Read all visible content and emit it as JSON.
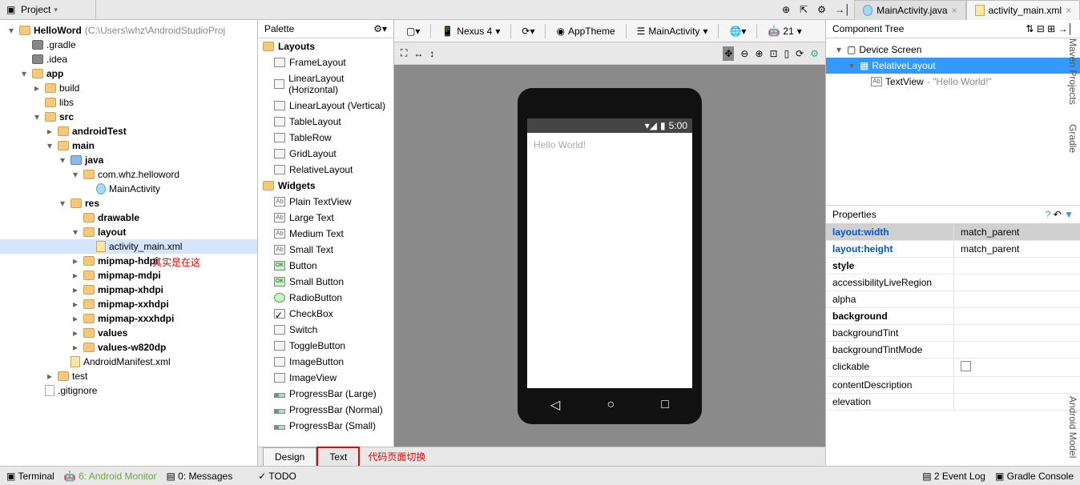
{
  "toolbar": {
    "project_label": "Project"
  },
  "editor_tabs": [
    {
      "icon": "c",
      "label": "MainActivity.java"
    },
    {
      "icon": "xml",
      "label": "activity_main.xml"
    }
  ],
  "tree": {
    "root": "HelloWord",
    "root_path": "(C:\\Users\\whz\\AndroidStudioProj",
    "items": [
      {
        "d": 1,
        "e": "",
        "i": "fold-dark",
        "t": ".gradle"
      },
      {
        "d": 1,
        "e": "",
        "i": "fold-dark",
        "t": ".idea"
      },
      {
        "d": 1,
        "e": "▾",
        "i": "fold",
        "t": "app",
        "b": 1
      },
      {
        "d": 2,
        "e": "▸",
        "i": "fold",
        "t": "build"
      },
      {
        "d": 2,
        "e": "",
        "i": "fold",
        "t": "libs"
      },
      {
        "d": 2,
        "e": "▾",
        "i": "fold",
        "t": "src",
        "b": 1
      },
      {
        "d": 3,
        "e": "▸",
        "i": "fold",
        "t": "androidTest",
        "b": 1
      },
      {
        "d": 3,
        "e": "▾",
        "i": "fold",
        "t": "main",
        "b": 1
      },
      {
        "d": 4,
        "e": "▾",
        "i": "fold-blue",
        "t": "java",
        "b": 1
      },
      {
        "d": 5,
        "e": "▾",
        "i": "fold",
        "t": "com.whz.helloword"
      },
      {
        "d": 6,
        "e": "",
        "i": "c",
        "t": "MainActivity"
      },
      {
        "d": 4,
        "e": "▾",
        "i": "fold",
        "t": "res",
        "b": 1
      },
      {
        "d": 5,
        "e": "",
        "i": "fold",
        "t": "drawable",
        "b": 1
      },
      {
        "d": 5,
        "e": "▾",
        "i": "fold",
        "t": "layout",
        "b": 1
      },
      {
        "d": 6,
        "e": "",
        "i": "xml",
        "t": "activity_main.xml",
        "sel": 1
      },
      {
        "d": 5,
        "e": "▸",
        "i": "fold",
        "t": "mipmap-hdpi",
        "b": 1
      },
      {
        "d": 5,
        "e": "▸",
        "i": "fold",
        "t": "mipmap-mdpi",
        "b": 1
      },
      {
        "d": 5,
        "e": "▸",
        "i": "fold",
        "t": "mipmap-xhdpi",
        "b": 1
      },
      {
        "d": 5,
        "e": "▸",
        "i": "fold",
        "t": "mipmap-xxhdpi",
        "b": 1
      },
      {
        "d": 5,
        "e": "▸",
        "i": "fold",
        "t": "mipmap-xxxhdpi",
        "b": 1
      },
      {
        "d": 5,
        "e": "▸",
        "i": "fold",
        "t": "values",
        "b": 1
      },
      {
        "d": 5,
        "e": "▸",
        "i": "fold",
        "t": "values-w820dp",
        "b": 1
      },
      {
        "d": 4,
        "e": "",
        "i": "xml",
        "t": "AndroidManifest.xml"
      },
      {
        "d": 3,
        "e": "▸",
        "i": "fold",
        "t": "test"
      },
      {
        "d": 2,
        "e": "",
        "i": "file",
        "t": ".gitignore"
      }
    ]
  },
  "palette": {
    "title": "Palette",
    "groups": [
      {
        "name": "Layouts",
        "items": [
          "FrameLayout",
          "LinearLayout (Horizontal)",
          "LinearLayout (Vertical)",
          "TableLayout",
          "TableRow",
          "GridLayout",
          "RelativeLayout"
        ]
      },
      {
        "name": "Widgets",
        "items": [
          "Plain TextView",
          "Large Text",
          "Medium Text",
          "Small Text",
          "Button",
          "Small Button",
          "RadioButton",
          "CheckBox",
          "Switch",
          "ToggleButton",
          "ImageButton",
          "ImageView",
          "ProgressBar (Large)",
          "ProgressBar (Normal)",
          "ProgressBar (Small)"
        ]
      }
    ]
  },
  "design_toolbar": {
    "device": "Nexus 4",
    "theme": "AppTheme",
    "activity": "MainActivity",
    "api": "21"
  },
  "phone": {
    "time": "5:00",
    "content": "Hello World!"
  },
  "component_tree": {
    "title": "Component Tree",
    "root": "Device Screen",
    "layout": "RelativeLayout",
    "child": "TextView",
    "child_text": "\"Hello World!\""
  },
  "properties": {
    "title": "Properties",
    "rows": [
      {
        "k": "layout:width",
        "v": "match_parent",
        "hdr": 1,
        "blue": 1
      },
      {
        "k": "layout:height",
        "v": "match_parent",
        "blue": 1
      },
      {
        "k": "style",
        "v": "",
        "bold": 1
      },
      {
        "k": "accessibilityLiveRegion",
        "v": ""
      },
      {
        "k": "alpha",
        "v": ""
      },
      {
        "k": "background",
        "v": "",
        "bold": 1
      },
      {
        "k": "backgroundTint",
        "v": ""
      },
      {
        "k": "backgroundTintMode",
        "v": ""
      },
      {
        "k": "clickable",
        "v": "",
        "chk": 1
      },
      {
        "k": "contentDescription",
        "v": ""
      },
      {
        "k": "elevation",
        "v": ""
      }
    ]
  },
  "bottom_tabs": {
    "design": "Design",
    "text": "Text"
  },
  "annotations": {
    "tree": "其实是在这",
    "tabs": "代码页面切换"
  },
  "statusbar": {
    "terminal": "Terminal",
    "android_monitor": "6: Android Monitor",
    "messages": "0: Messages",
    "todo": "TODO",
    "event_log": "2  Event Log",
    "gradle_console": "Gradle Console"
  },
  "right_tabs": [
    "Maven Projects",
    "Gradle",
    "Android Model"
  ]
}
